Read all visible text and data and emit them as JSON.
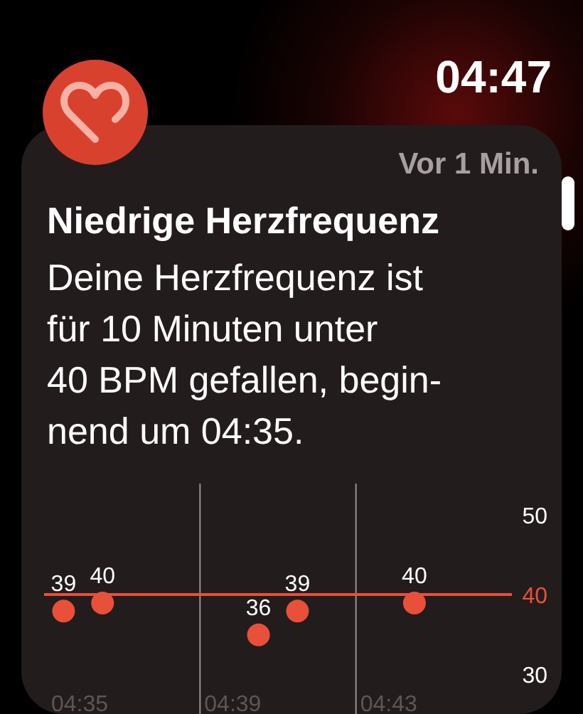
{
  "time": "04:47",
  "notification": {
    "age": "Vor 1 Min.",
    "title": "Niedrige Herzfrequenz",
    "body_lines": [
      "Deine Herzfrequenz ist",
      "für 10 Minuten unter",
      "40 BPM gefallen, begin-",
      "nend um 04:35."
    ],
    "chart_data": {
      "type": "scatter",
      "categories": [
        "04:35",
        null,
        null,
        null,
        "04:39",
        null,
        null,
        null,
        "04:43",
        null,
        null,
        null
      ],
      "series": [
        {
          "color": "#e8503a",
          "values": [
            39,
            40,
            null,
            null,
            null,
            36,
            39,
            null,
            null,
            40,
            null,
            null
          ]
        }
      ],
      "ylim": [
        30,
        50
      ],
      "yticks": [
        30,
        50
      ],
      "data_labels": true,
      "ref_lines": [
        {
          "axis": "y",
          "value": 40,
          "label": "40"
        }
      ]
    }
  }
}
